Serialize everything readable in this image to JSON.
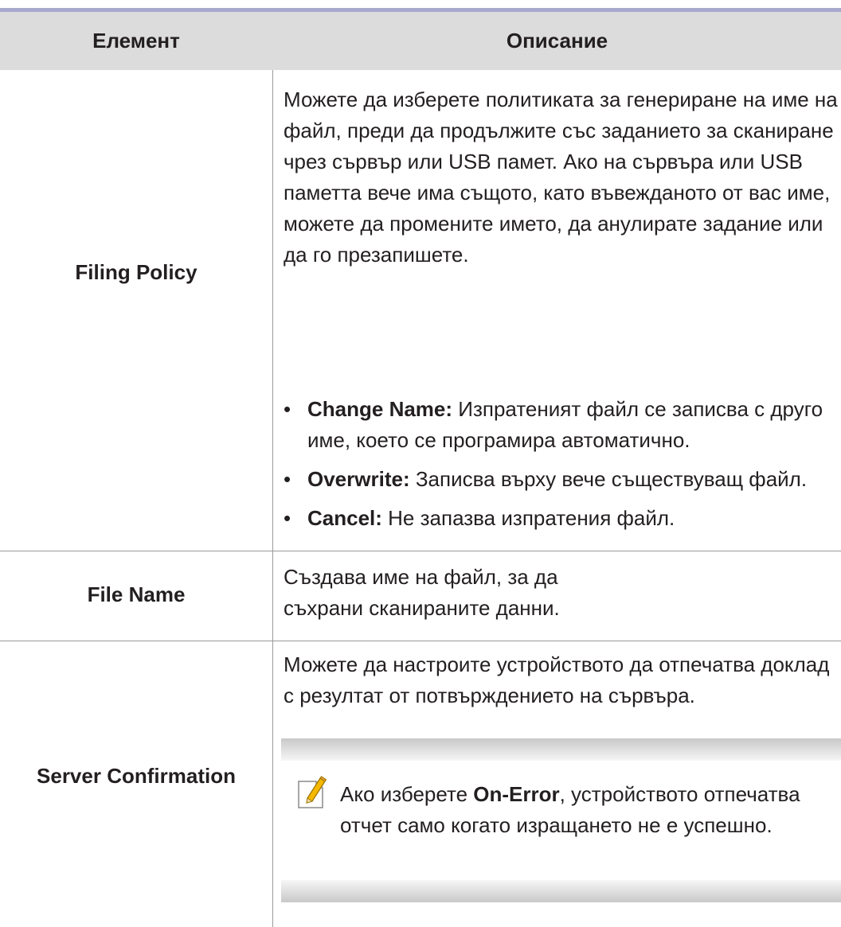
{
  "table": {
    "header": {
      "item": "Елемент",
      "description": "Описание"
    },
    "rows": [
      {
        "item": "Filing Policy",
        "description": "Можете да изберете политиката за генериране на име на файл, преди да продължите със заданието за сканиране чрез сървър или USB памет. Ако на сървъра или USB паметта вече има същото, като въвежданото от вас име, можете да промените името, да анулирате задание или да го презапишете.",
        "bullets": [
          {
            "term": "Change Name:",
            "text": "Изпратеният файл се записва с друго име, което се програмира автоматично."
          },
          {
            "term": "Overwrite:",
            "text": "Записва върху вече съществуващ файл."
          },
          {
            "term": "Cancel:",
            "text": "Не запазва изпратения файл."
          }
        ]
      },
      {
        "item": "File Name",
        "description": "Създава име на файл, за да съхрани сканираните данни."
      },
      {
        "item": "Server Confirmation",
        "description": "Можете да настроите устройството да отпечатва доклад с резултат от потвърждението на сървъра.",
        "note": {
          "icon": "note-pencil-icon",
          "before": "Ако изберете ",
          "term": "On-Error",
          "after": ", устройството отпечатва отчет само когато изращането не е успешно."
        }
      }
    ]
  }
}
